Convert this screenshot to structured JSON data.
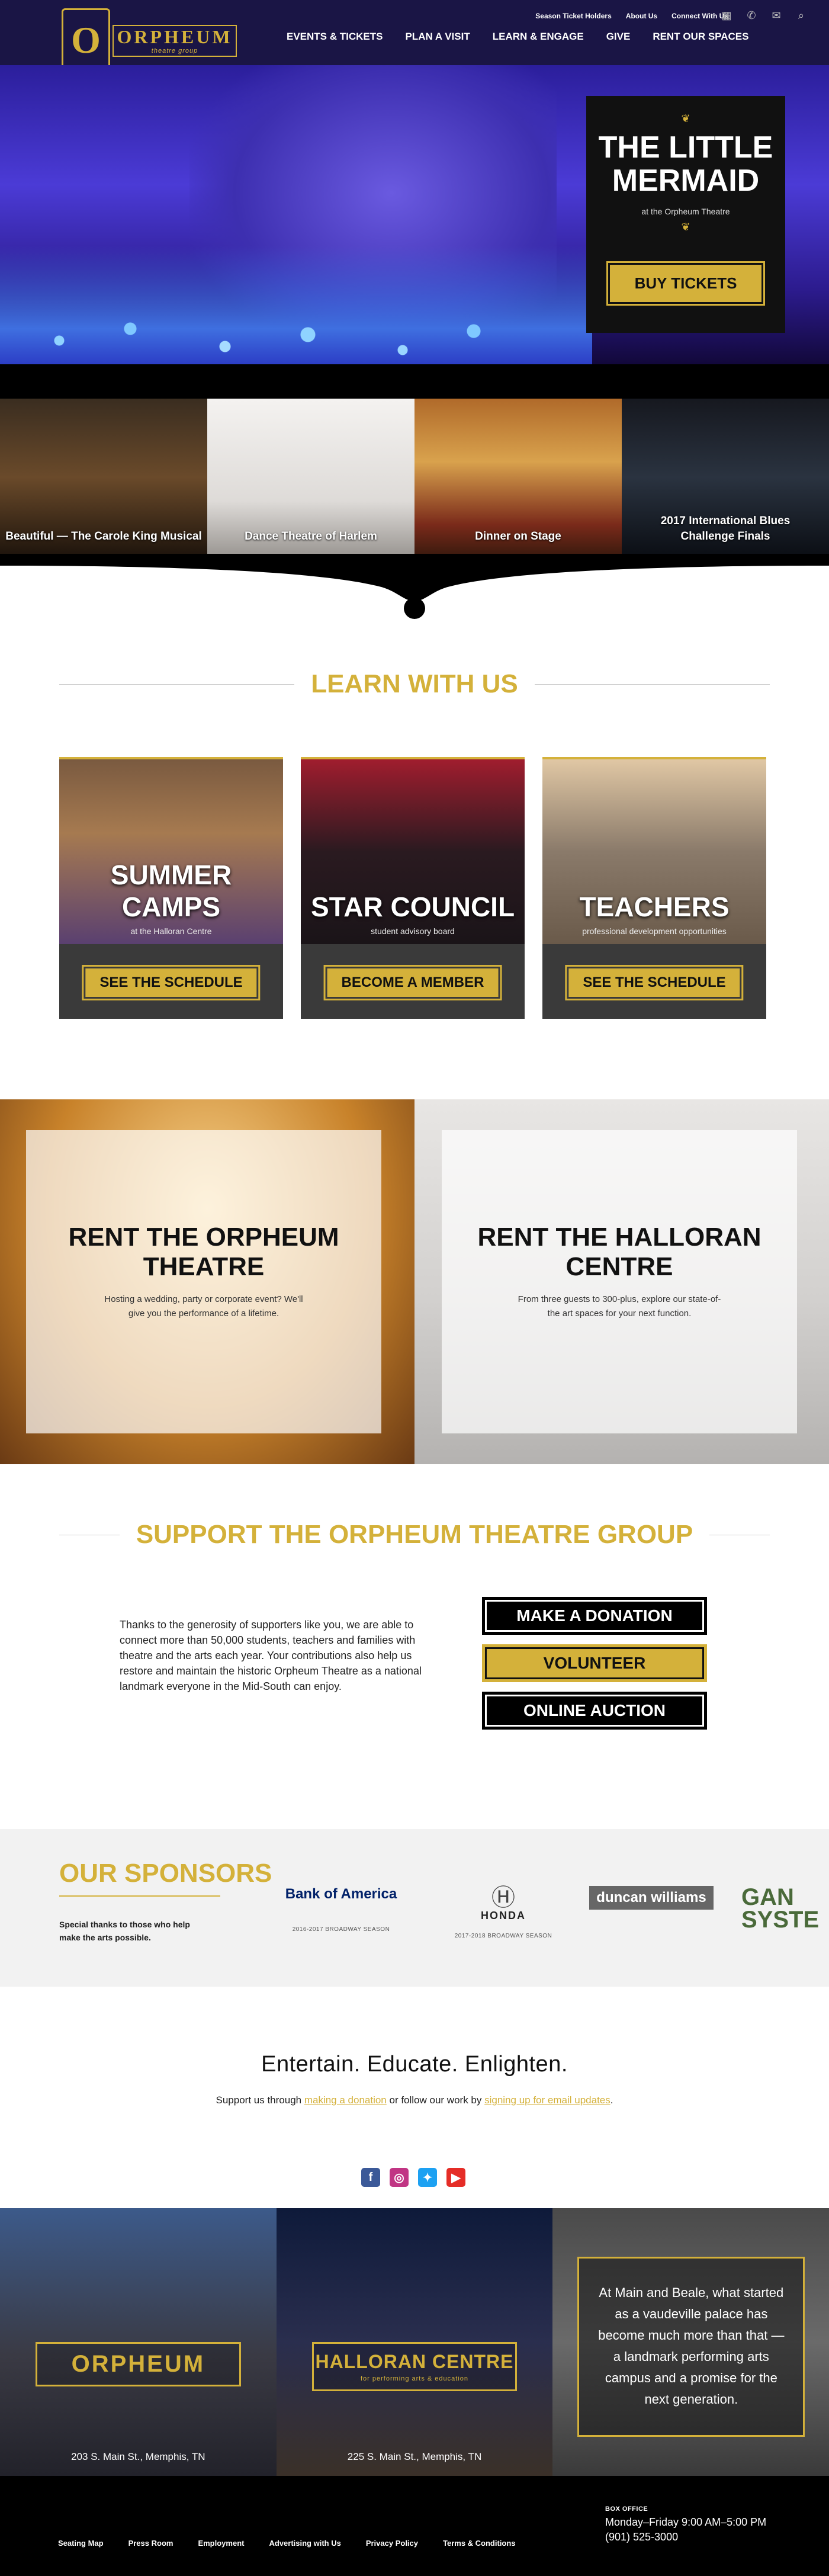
{
  "header": {
    "logo_letter": "O",
    "logo_name": "ORPHEUM",
    "logo_sub": "theatre group",
    "util_nav": [
      "Season Ticket Holders",
      "About Us",
      "Connect With Us"
    ],
    "main_nav": [
      "EVENTS & TICKETS",
      "PLAN A VISIT",
      "LEARN & ENGAGE",
      "GIVE",
      "RENT OUR SPACES"
    ]
  },
  "hero": {
    "title_line1": "THE LITTLE",
    "title_line2": "MERMAID",
    "subtitle": "at the Orpheum Theatre",
    "button": "BUY TICKETS"
  },
  "shows": [
    {
      "label": "Beautiful — The Carole King Musical"
    },
    {
      "label": "Dance Theatre of Harlem"
    },
    {
      "label": "Dinner on Stage"
    },
    {
      "label": "2017 International Blues Challenge Finals"
    }
  ],
  "learn": {
    "heading": "LEARN WITH US",
    "cards": [
      {
        "title": "SUMMER CAMPS",
        "sub": "at the Halloran Centre",
        "button": "SEE THE SCHEDULE"
      },
      {
        "title": "STAR COUNCIL",
        "sub": "student advisory board",
        "button": "BECOME A MEMBER"
      },
      {
        "title": "TEACHERS",
        "sub": "professional development opportunities",
        "button": "SEE THE SCHEDULE"
      }
    ]
  },
  "rent": {
    "orpheum_title": "RENT THE ORPHEUM THEATRE",
    "orpheum_text": "Hosting a wedding, party or corporate event? We'll give you the performance of a lifetime.",
    "halloran_title": "RENT THE HALLORAN CENTRE",
    "halloran_text": "From three guests to 300-plus, explore our state-of-the art spaces for your next function."
  },
  "support": {
    "heading": "SUPPORT THE ORPHEUM THEATRE GROUP",
    "text": "Thanks to the generosity of supporters like you, we are able to connect more than 50,000 students, teachers and families with theatre and the arts each year. Your contributions also help us restore and maintain the historic Orpheum Theatre as a national landmark everyone in the Mid-South can enjoy.",
    "buttons": [
      "MAKE A DONATION",
      "VOLUNTEER",
      "ONLINE AUCTION"
    ]
  },
  "sponsors": {
    "title": "OUR SPONSORS",
    "subtitle": "Special thanks to those who help make the arts possible.",
    "logos": [
      {
        "name": "Bank of America",
        "note": "2016-2017 BROADWAY SEASON"
      },
      {
        "name": "HONDA",
        "note": "2017-2018 BROADWAY SEASON"
      },
      {
        "name": "duncan williams",
        "note": ""
      },
      {
        "name": "GAN SYSTE",
        "note": ""
      }
    ]
  },
  "tagline": {
    "headline": "Entertain. Educate. Enlighten.",
    "pre": "Support us through ",
    "link1": "making a donation",
    "mid": " or follow our work by ",
    "link2": "signing up for email updates",
    "post": "."
  },
  "venues": {
    "orpheum_name": "ORPHEUM",
    "orpheum_addr": "203 S. Main St., Memphis, TN",
    "halloran_name": "HALLORAN CENTRE",
    "halloran_sub": "for performing arts & education",
    "halloran_addr": "225 S. Main St., Memphis, TN",
    "story": "At Main and Beale, what started as a vaudeville palace has become much more than that — a landmark performing arts campus and a promise for the next generation."
  },
  "footer": {
    "links": [
      "Seating Map",
      "Press Room",
      "Employment",
      "Advertising with Us",
      "Privacy Policy",
      "Terms & Conditions"
    ],
    "box_label": "BOX OFFICE",
    "hours": "Monday–Friday 9:00 AM–5:00 PM",
    "phone": "(901) 525-3000"
  },
  "colors": {
    "gold": "#d4b13a",
    "navy": "#1a1545",
    "black": "#000000"
  }
}
